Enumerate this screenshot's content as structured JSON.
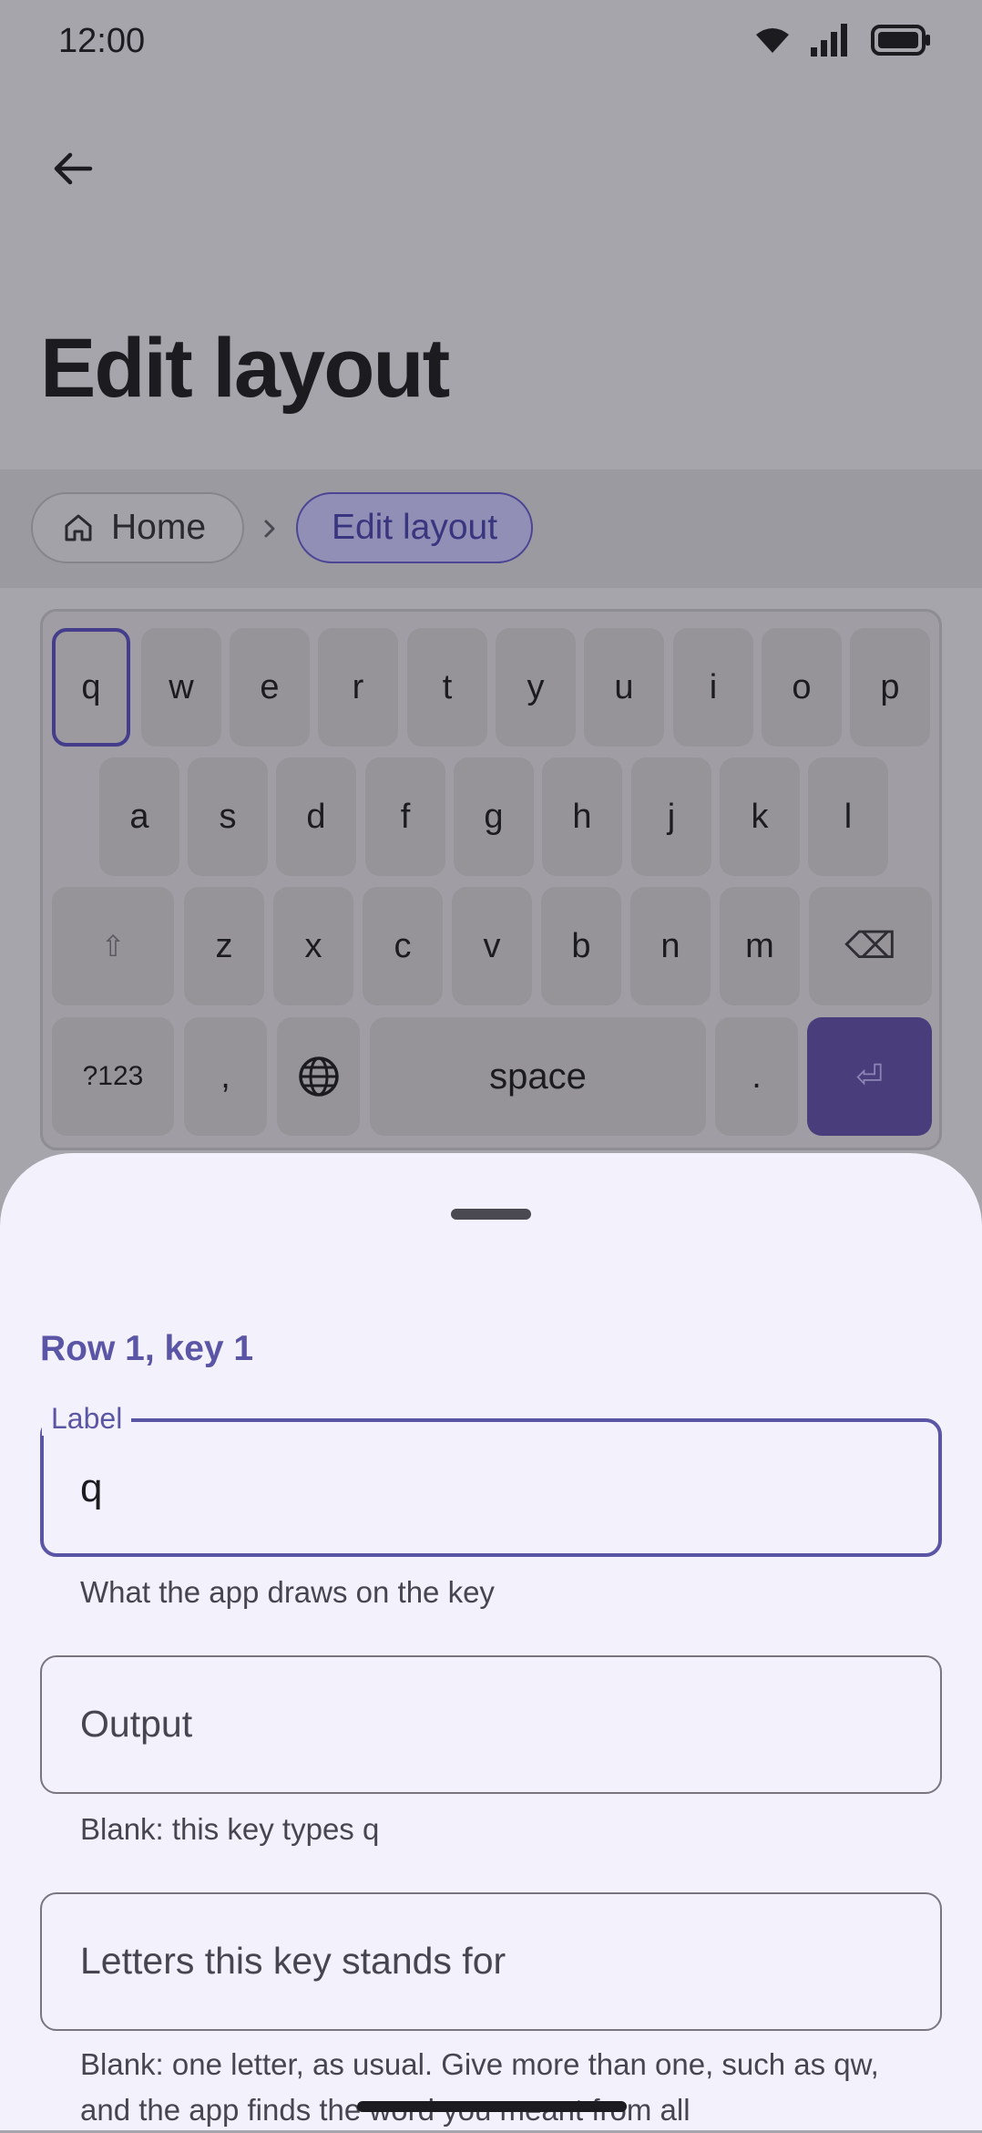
{
  "status": {
    "time": "12:00",
    "icons": [
      "wifi-icon",
      "signal-icon",
      "battery-icon"
    ]
  },
  "header": {
    "back_icon": "arrow-left-icon",
    "title": "Edit layout"
  },
  "breadcrumb": {
    "home_icon": "home-icon",
    "home": "Home",
    "separator_icon": "chevron-right-icon",
    "current": "Edit layout"
  },
  "keyboard": {
    "selected_key": "q",
    "rows": [
      [
        "q",
        "w",
        "e",
        "r",
        "t",
        "y",
        "u",
        "i",
        "o",
        "p"
      ],
      [
        "a",
        "s",
        "d",
        "f",
        "g",
        "h",
        "j",
        "k",
        "l"
      ],
      [
        "⇧",
        "z",
        "x",
        "c",
        "v",
        "b",
        "n",
        "m",
        "⌫"
      ],
      [
        "?123",
        ",",
        "globe-icon",
        "space",
        ".",
        "⏎"
      ]
    ]
  },
  "sheet": {
    "title": "Row 1, key 1",
    "label_field": {
      "label": "Label",
      "value": "q",
      "helper": "What the app draws on the key"
    },
    "output_field": {
      "placeholder": "Output",
      "helper": "Blank: this key types q"
    },
    "letters_field": {
      "placeholder": "Letters this key stands for",
      "helper": "Blank: one letter, as usual. Give more than one, such as qw, and the app finds the word you meant from all"
    }
  },
  "colors": {
    "accent": "#5b55a6",
    "enter_key": "#4a3d7c",
    "sheet_bg": "#f3f1fb",
    "scrim_bg": "#a6a5ab"
  }
}
